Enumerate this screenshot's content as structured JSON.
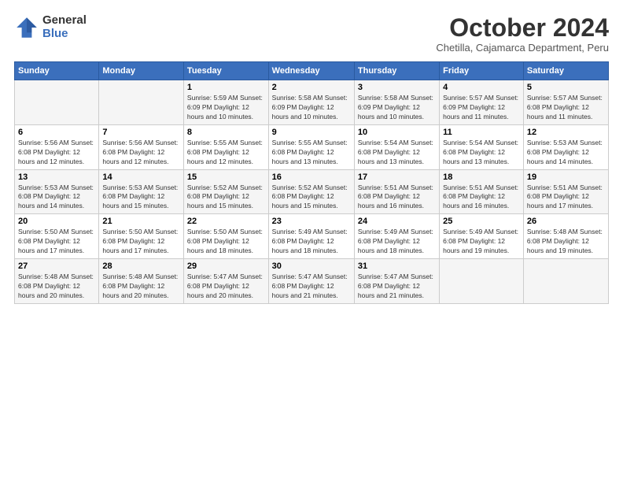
{
  "header": {
    "logo_general": "General",
    "logo_blue": "Blue",
    "title": "October 2024",
    "subtitle": "Chetilla, Cajamarca Department, Peru"
  },
  "calendar": {
    "days_of_week": [
      "Sunday",
      "Monday",
      "Tuesday",
      "Wednesday",
      "Thursday",
      "Friday",
      "Saturday"
    ],
    "weeks": [
      [
        {
          "day": "",
          "info": ""
        },
        {
          "day": "",
          "info": ""
        },
        {
          "day": "1",
          "info": "Sunrise: 5:59 AM\nSunset: 6:09 PM\nDaylight: 12 hours and 10 minutes."
        },
        {
          "day": "2",
          "info": "Sunrise: 5:58 AM\nSunset: 6:09 PM\nDaylight: 12 hours and 10 minutes."
        },
        {
          "day": "3",
          "info": "Sunrise: 5:58 AM\nSunset: 6:09 PM\nDaylight: 12 hours and 10 minutes."
        },
        {
          "day": "4",
          "info": "Sunrise: 5:57 AM\nSunset: 6:09 PM\nDaylight: 12 hours and 11 minutes."
        },
        {
          "day": "5",
          "info": "Sunrise: 5:57 AM\nSunset: 6:08 PM\nDaylight: 12 hours and 11 minutes."
        }
      ],
      [
        {
          "day": "6",
          "info": "Sunrise: 5:56 AM\nSunset: 6:08 PM\nDaylight: 12 hours and 12 minutes."
        },
        {
          "day": "7",
          "info": "Sunrise: 5:56 AM\nSunset: 6:08 PM\nDaylight: 12 hours and 12 minutes."
        },
        {
          "day": "8",
          "info": "Sunrise: 5:55 AM\nSunset: 6:08 PM\nDaylight: 12 hours and 12 minutes."
        },
        {
          "day": "9",
          "info": "Sunrise: 5:55 AM\nSunset: 6:08 PM\nDaylight: 12 hours and 13 minutes."
        },
        {
          "day": "10",
          "info": "Sunrise: 5:54 AM\nSunset: 6:08 PM\nDaylight: 12 hours and 13 minutes."
        },
        {
          "day": "11",
          "info": "Sunrise: 5:54 AM\nSunset: 6:08 PM\nDaylight: 12 hours and 13 minutes."
        },
        {
          "day": "12",
          "info": "Sunrise: 5:53 AM\nSunset: 6:08 PM\nDaylight: 12 hours and 14 minutes."
        }
      ],
      [
        {
          "day": "13",
          "info": "Sunrise: 5:53 AM\nSunset: 6:08 PM\nDaylight: 12 hours and 14 minutes."
        },
        {
          "day": "14",
          "info": "Sunrise: 5:53 AM\nSunset: 6:08 PM\nDaylight: 12 hours and 15 minutes."
        },
        {
          "day": "15",
          "info": "Sunrise: 5:52 AM\nSunset: 6:08 PM\nDaylight: 12 hours and 15 minutes."
        },
        {
          "day": "16",
          "info": "Sunrise: 5:52 AM\nSunset: 6:08 PM\nDaylight: 12 hours and 15 minutes."
        },
        {
          "day": "17",
          "info": "Sunrise: 5:51 AM\nSunset: 6:08 PM\nDaylight: 12 hours and 16 minutes."
        },
        {
          "day": "18",
          "info": "Sunrise: 5:51 AM\nSunset: 6:08 PM\nDaylight: 12 hours and 16 minutes."
        },
        {
          "day": "19",
          "info": "Sunrise: 5:51 AM\nSunset: 6:08 PM\nDaylight: 12 hours and 17 minutes."
        }
      ],
      [
        {
          "day": "20",
          "info": "Sunrise: 5:50 AM\nSunset: 6:08 PM\nDaylight: 12 hours and 17 minutes."
        },
        {
          "day": "21",
          "info": "Sunrise: 5:50 AM\nSunset: 6:08 PM\nDaylight: 12 hours and 17 minutes."
        },
        {
          "day": "22",
          "info": "Sunrise: 5:50 AM\nSunset: 6:08 PM\nDaylight: 12 hours and 18 minutes."
        },
        {
          "day": "23",
          "info": "Sunrise: 5:49 AM\nSunset: 6:08 PM\nDaylight: 12 hours and 18 minutes."
        },
        {
          "day": "24",
          "info": "Sunrise: 5:49 AM\nSunset: 6:08 PM\nDaylight: 12 hours and 18 minutes."
        },
        {
          "day": "25",
          "info": "Sunrise: 5:49 AM\nSunset: 6:08 PM\nDaylight: 12 hours and 19 minutes."
        },
        {
          "day": "26",
          "info": "Sunrise: 5:48 AM\nSunset: 6:08 PM\nDaylight: 12 hours and 19 minutes."
        }
      ],
      [
        {
          "day": "27",
          "info": "Sunrise: 5:48 AM\nSunset: 6:08 PM\nDaylight: 12 hours and 20 minutes."
        },
        {
          "day": "28",
          "info": "Sunrise: 5:48 AM\nSunset: 6:08 PM\nDaylight: 12 hours and 20 minutes."
        },
        {
          "day": "29",
          "info": "Sunrise: 5:47 AM\nSunset: 6:08 PM\nDaylight: 12 hours and 20 minutes."
        },
        {
          "day": "30",
          "info": "Sunrise: 5:47 AM\nSunset: 6:08 PM\nDaylight: 12 hours and 21 minutes."
        },
        {
          "day": "31",
          "info": "Sunrise: 5:47 AM\nSunset: 6:08 PM\nDaylight: 12 hours and 21 minutes."
        },
        {
          "day": "",
          "info": ""
        },
        {
          "day": "",
          "info": ""
        }
      ]
    ]
  }
}
